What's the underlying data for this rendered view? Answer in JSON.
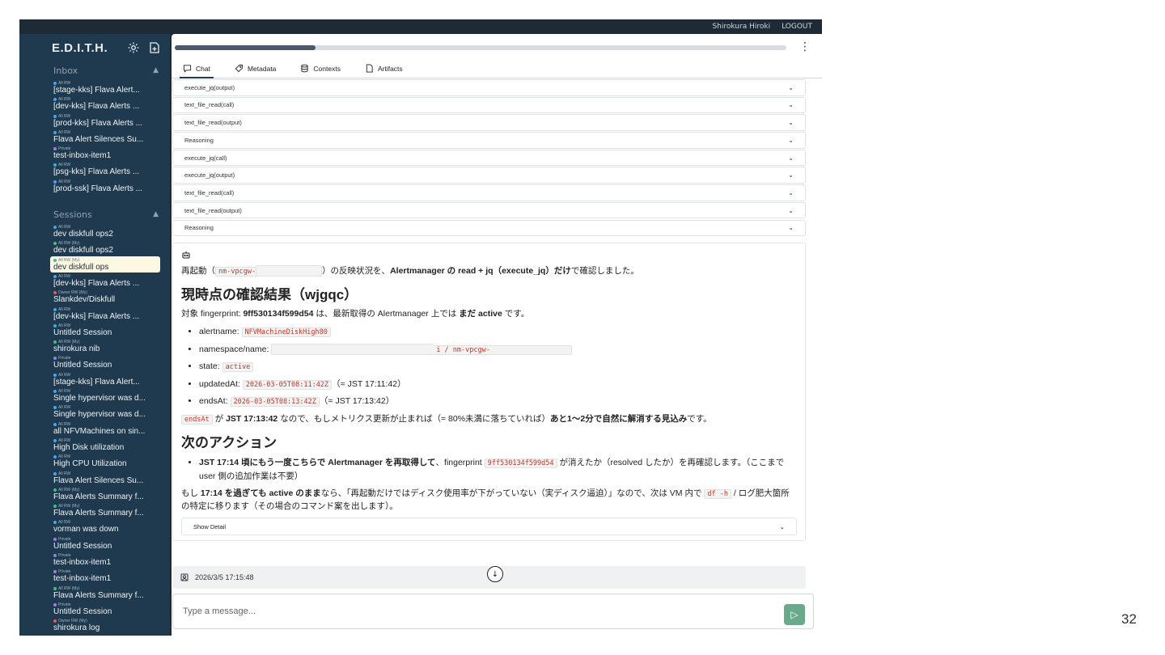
{
  "topbar": {
    "user": "Shirokura Hiroki",
    "logout": "LOGOUT"
  },
  "sidebar": {
    "brand": "E.D.I.T.H.",
    "inbox_label": "Inbox",
    "inbox": [
      {
        "tag": "All RW",
        "dot": "#3fa9f5",
        "title": "[stage-kks] Flava Alert..."
      },
      {
        "tag": "All RW",
        "dot": "#3fa9f5",
        "title": "[dev-kks] Flava Alerts ..."
      },
      {
        "tag": "All RW",
        "dot": "#3fa9f5",
        "title": "[prod-kks] Flava Alerts ..."
      },
      {
        "tag": "All RW",
        "dot": "#3fa9f5",
        "title": "Flava Alert Silences Su..."
      },
      {
        "tag": "Private",
        "dot": "#9b7fe0",
        "title": "test-inbox-item1"
      },
      {
        "tag": "All RW",
        "dot": "#3fa9f5",
        "title": "[psg-kks] Flava Alerts ..."
      },
      {
        "tag": "All RW",
        "dot": "#3fa9f5",
        "title": "[prod-ssk] Flava Alerts ..."
      }
    ],
    "sessions_label": "Sessions",
    "sessions": [
      {
        "tag": "All RW",
        "dot": "#3fa9f5",
        "title": "dev diskfull ops2"
      },
      {
        "tag": "All RW (My)",
        "dot": "#3fc08a",
        "title": "dev diskfull ops2"
      },
      {
        "tag": "All RW (My)",
        "dot": "#3fc08a",
        "title": "dev diskfull ops",
        "active": true
      },
      {
        "tag": "All RW",
        "dot": "#3fa9f5",
        "title": "[dev-kks] Flava Alerts ..."
      },
      {
        "tag": "Owner RW (My)",
        "dot": "#e25c5c",
        "title": "Slankdev/Diskfull"
      },
      {
        "tag": "All RW",
        "dot": "#3fa9f5",
        "title": "[dev-kks] Flava Alerts ..."
      },
      {
        "tag": "All RW",
        "dot": "#3fa9f5",
        "title": "Untitled Session"
      },
      {
        "tag": "All RW (My)",
        "dot": "#3fc08a",
        "title": "shirokura nib"
      },
      {
        "tag": "Private",
        "dot": "#9b7fe0",
        "title": "Untitled Session"
      },
      {
        "tag": "All RW",
        "dot": "#3fa9f5",
        "title": "[stage-kks] Flava Alert..."
      },
      {
        "tag": "All RW",
        "dot": "#3fa9f5",
        "title": "Single hypervisor was d..."
      },
      {
        "tag": "All RW",
        "dot": "#3fa9f5",
        "title": "Single hypervisor was d..."
      },
      {
        "tag": "All RW",
        "dot": "#3fa9f5",
        "title": "all NFVMachines on sin..."
      },
      {
        "tag": "All RW",
        "dot": "#3fa9f5",
        "title": "High Disk utilization"
      },
      {
        "tag": "All RW",
        "dot": "#3fa9f5",
        "title": "High CPU Utilization"
      },
      {
        "tag": "All RW",
        "dot": "#3fa9f5",
        "title": "Flava Alert Silences Su..."
      },
      {
        "tag": "All RW (My)",
        "dot": "#3fc08a",
        "title": "Flava Alerts Summary f..."
      },
      {
        "tag": "All RW (My)",
        "dot": "#3fc08a",
        "title": "Flava Alerts Summary f..."
      },
      {
        "tag": "All RW",
        "dot": "#3fa9f5",
        "title": "vorman was down"
      },
      {
        "tag": "Private",
        "dot": "#9b7fe0",
        "title": "Untitled Session"
      },
      {
        "tag": "Private",
        "dot": "#9b7fe0",
        "title": "test-inbox-item1"
      },
      {
        "tag": "Private",
        "dot": "#9b7fe0",
        "title": "test-inbox-item1"
      },
      {
        "tag": "All RW (My)",
        "dot": "#3fc08a",
        "title": "Flava Alerts Summary f..."
      },
      {
        "tag": "Private",
        "dot": "#9b7fe0",
        "title": "Untitled Session"
      },
      {
        "tag": "Owner RW (My)",
        "dot": "#e25c5c",
        "title": "shirokura log"
      }
    ]
  },
  "progress": 0.23,
  "tabs": [
    {
      "label": "Chat",
      "icon": "chat-bubble-icon"
    },
    {
      "label": "Metadata",
      "icon": "tag-icon"
    },
    {
      "label": "Contexts",
      "icon": "database-icon"
    },
    {
      "label": "Artifacts",
      "icon": "file-icon"
    }
  ],
  "accordions": [
    "execute_jq(output)",
    "text_file_read(call)",
    "text_file_read(output)",
    "Reasoning",
    "execute_jq(call)",
    "execute_jq(output)",
    "text_file_read(call)",
    "text_file_read(output)",
    "Reasoning"
  ],
  "answer": {
    "intro_pre": "再起動（",
    "intro_code": "nm-vpcgw-",
    "intro_mid": "）の反映状況を、",
    "intro_bold": "Alertmanager の read + jq（execute_jq）だけ",
    "intro_post": "で確認しました。",
    "h1": "現時点の確認結果（wjgqc）",
    "p1_pre": "対象 fingerprint: ",
    "p1_fp": "9ff530134f599d54",
    "p1_mid": " は、最新取得の Alertmanager 上では ",
    "p1_bold": "まだ active",
    "p1_post": " です。",
    "bullets": [
      {
        "label": "alertname: ",
        "code": "NFVMachineDiskHigh80",
        "after": ""
      },
      {
        "label": "namespace/name: ",
        "code": "i / nm-vpcgw-",
        "after": ""
      },
      {
        "label": "state: ",
        "code": "active",
        "after": ""
      },
      {
        "label": "updatedAt: ",
        "code": "2026-03-05T08:11:42Z",
        "after": "（= JST 17:11:42）"
      },
      {
        "label": "endsAt: ",
        "code": "2026-03-05T08:13:42Z",
        "after": "（= JST 17:13:42）"
      }
    ],
    "p2_code": "endsAt",
    "p2_pre": " が ",
    "p2_bold1": "JST 17:13:42",
    "p2_mid": " なので、もしメトリクス更新が止まれば（= 80%未満に落ちていれば）",
    "p2_bold2": "あと1〜2分で自然に解消する見込み",
    "p2_post": "です。",
    "h2": "次のアクション",
    "action_bold": "JST 17:14 頃にもう一度こちらで Alertmanager を再取得して",
    "action_mid": "、fingerprint ",
    "action_code": "9ff530134f599d54",
    "action_post": " が消えたか（resolved したか）を再確認します。（ここまで user 側の追加作業は不要）",
    "p3_pre": "もし ",
    "p3_bold": "17:14 を過ぎても active のまま",
    "p3_mid": "なら、「再起動だけではディスク使用率が下がっていない（実ディスク逼迫）」なので、次は VM 内で ",
    "p3_code": "df -h",
    "p3_post": " / ログ肥大箇所の特定に移ります（その場合のコマンド案を出します）。",
    "show_detail": "Show Detail"
  },
  "user_msg_time": "2026/3/5 17:15:48",
  "composer": {
    "placeholder": "Type a message..."
  },
  "slide_number": "32"
}
